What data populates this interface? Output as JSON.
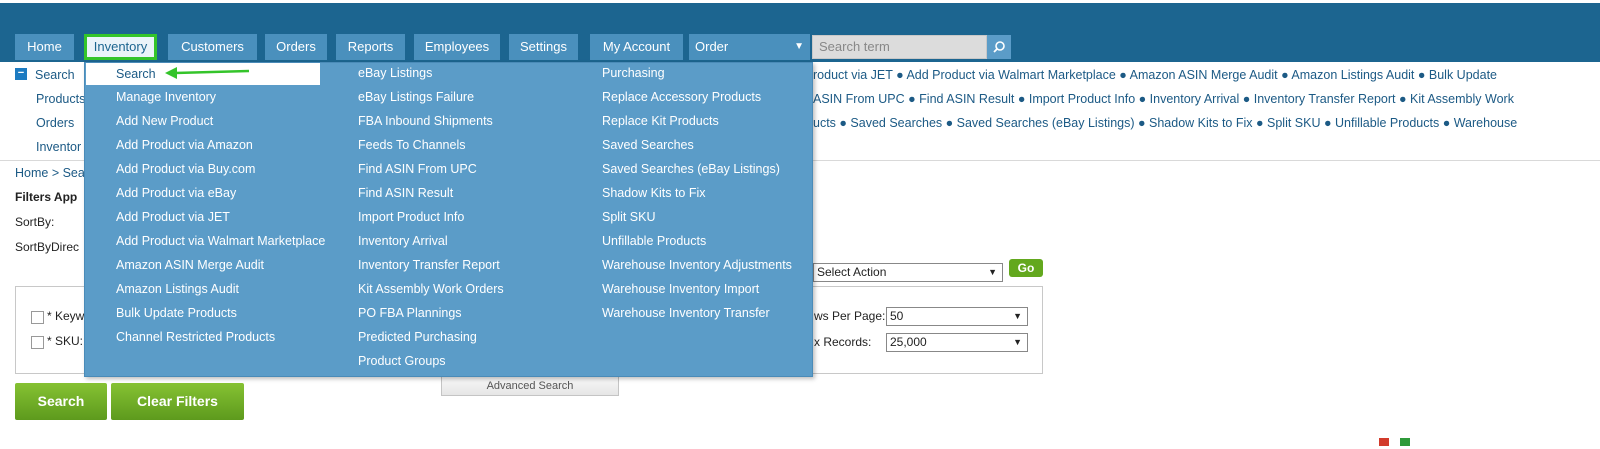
{
  "nav": {
    "tabs": [
      {
        "label": "Home"
      },
      {
        "label": "Inventory"
      },
      {
        "label": "Customers"
      },
      {
        "label": "Orders"
      },
      {
        "label": "Reports"
      },
      {
        "label": "Employees"
      },
      {
        "label": "Settings"
      },
      {
        "label": "My Account"
      }
    ],
    "order_select": "Order",
    "search_placeholder": "Search term",
    "active_tab": "Inventory"
  },
  "quick_links": {
    "collapse_symbol": "−",
    "left_lines": [
      "Search",
      "Products",
      "Orders",
      "Inventor"
    ],
    "right_lines": [
      "roduct via JET ● Add Product via Walmart Marketplace ● Amazon ASIN Merge Audit ● Amazon Listings Audit ● Bulk Update",
      " ASIN From UPC ● Find ASIN Result ● Import Product Info ● Inventory Arrival ● Inventory Transfer Report ● Kit Assembly Work",
      "ucts ● Saved Searches ● Saved Searches (eBay Listings) ● Shadow Kits to Fix ● Split SKU ● Unfillable Products ● Warehouse"
    ]
  },
  "breadcrumb": "Home > Sea",
  "page_labels": {
    "filters": "Filters App",
    "sortby": "SortBy:",
    "sortdir": "SortByDirec"
  },
  "filters": {
    "keyword_label": "* Keyw",
    "sku_label": "* SKU:",
    "rows_per_page_label": "ws Per Page:",
    "rows_per_page_value": "50",
    "max_records_label": "x Records:",
    "max_records_value": "25,000",
    "action_select": "Select Action",
    "go_label": "Go",
    "advanced_search_label": "Advanced Search"
  },
  "buttons": {
    "search": "Search",
    "clear_filters": "Clear Filters"
  },
  "dropdown": {
    "col1": [
      "Search",
      "Manage Inventory",
      "Add New Product",
      "Add Product via Amazon",
      "Add Product via Buy.com",
      "Add Product via eBay",
      "Add Product via JET",
      "Add Product via Walmart Marketplace",
      "Amazon ASIN Merge Audit",
      "Amazon Listings Audit",
      "Bulk Update Products",
      "Channel Restricted Products"
    ],
    "col2": [
      "eBay Listings",
      "eBay Listings Failure",
      "FBA Inbound Shipments",
      "Feeds To Channels",
      "Find ASIN From UPC",
      "Find ASIN Result",
      "Import Product Info",
      "Inventory Arrival",
      "Inventory Transfer Report",
      "Kit Assembly Work Orders",
      "PO FBA Plannings",
      "Predicted Purchasing",
      "Product Groups"
    ],
    "col3": [
      "Purchasing",
      "Replace Accessory Products",
      "Replace Kit Products",
      "Saved Searches",
      "Saved Searches (eBay Listings)",
      "Shadow Kits to Fix",
      "Split SKU",
      "Unfillable Products",
      "Warehouse Inventory Adjustments",
      "Warehouse Inventory Import",
      "Warehouse Inventory Transfer"
    ]
  },
  "colors": {
    "topbar": "#1c6590",
    "tab": "#4a90bd",
    "dropdown": "#5b9cc8",
    "accent_green": "#63a81e",
    "active_outline": "#34c42a"
  }
}
